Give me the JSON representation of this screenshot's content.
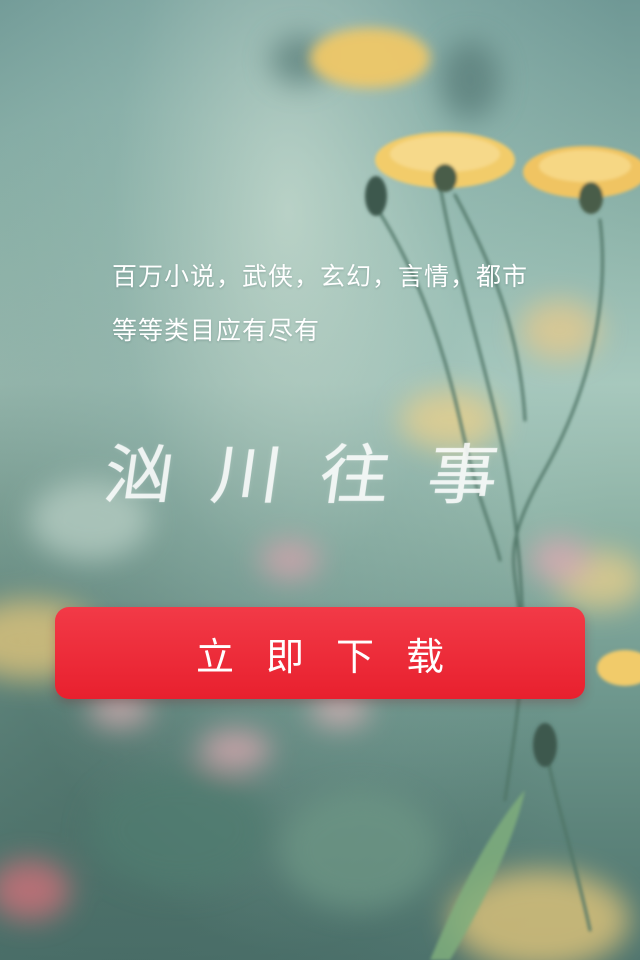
{
  "headline": {
    "line1": "百万小说，武侠，玄幻，言情，都市",
    "line2": "等等类目应有尽有"
  },
  "calligraphy_title": "汹川往事",
  "download_button": {
    "label": "立即下载"
  },
  "colors": {
    "button_red": "#e8202e",
    "text_white": "#ffffff",
    "background_teal": "#8fb5ab",
    "flower_yellow": "#f2c85a"
  }
}
